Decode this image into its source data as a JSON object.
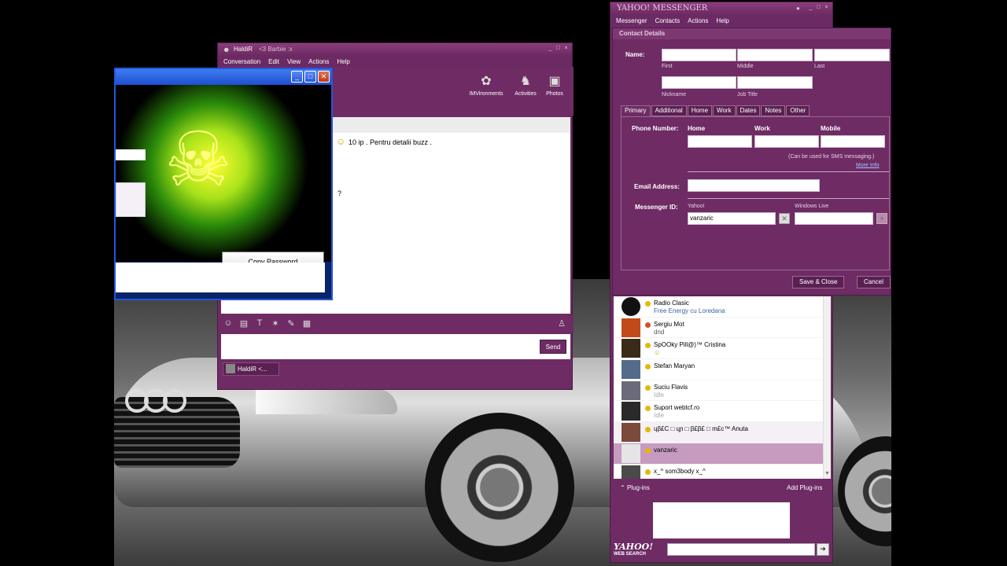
{
  "chat": {
    "title": "HaldiR",
    "title_suffix": "<3 Barbie :x",
    "menu": [
      "Conversation",
      "Edit",
      "View",
      "Actions",
      "Help"
    ],
    "tools": [
      {
        "label": "IMVironments",
        "icon": "imvironment-icon"
      },
      {
        "label": "Activities",
        "icon": "activities-icon"
      },
      {
        "label": "Photos",
        "icon": "photos-icon"
      }
    ],
    "message_line1": "10 ip . Pentru detalii buzz .",
    "message_line2": "?",
    "send_label": "Send",
    "tab_label": "HaldiR   <...",
    "accent": "#6e2b64"
  },
  "popup": {
    "copy_label": "Copy Password"
  },
  "messenger": {
    "title": "YAHOO! MESSENGER",
    "menu": [
      "Messenger",
      "Contacts",
      "Actions",
      "Help"
    ],
    "buddies": [
      {
        "name": "Radio Clasic",
        "status": "Free Energy cu Loredana",
        "status_color": "#3a62a8",
        "dot": "#e6b800",
        "avatar": "#111"
      },
      {
        "name": "Sergiu Mot",
        "status": "dnd",
        "status_color": "#555",
        "dot": "#d94f2a",
        "avatar": "#c24a1a"
      },
      {
        "name": "SpOOky Pill@)™ Cristina",
        "status": "☺",
        "status_color": "#c9a000",
        "dot": "#e6b800",
        "avatar": "#3a2a1a"
      },
      {
        "name": "Stefan Maryan",
        "status": "",
        "status_color": "#888",
        "dot": "#e6b800",
        "avatar": "#556b8a"
      },
      {
        "name": "Suciu Flavis",
        "status": "Idle",
        "status_color": "#aaa",
        "dot": "#e6b800",
        "avatar": "#6a6a7a"
      },
      {
        "name": "Suport webtcf.ro",
        "status": "Idle",
        "status_color": "#aaa",
        "dot": "#e6b800",
        "avatar": "#2a2a2a"
      },
      {
        "name": "ɥβ£Ϲ □ ɥɲ □ β£β£ □ m£c™ Anuta",
        "status": "",
        "status_color": "#888",
        "dot": "#e6b800",
        "avatar": "#7a4a3a"
      },
      {
        "name": "vanzaric",
        "status": "",
        "status_color": "#888",
        "dot": "#e6b800",
        "avatar": "#e5e5e5",
        "selected": true
      },
      {
        "name": "x_^ som3body x_^",
        "status": "",
        "status_color": "#888",
        "dot": "#e6b800",
        "avatar": "#4a4a4a"
      }
    ],
    "plugins_label": "Plug-ins",
    "add_plugins_label": "Add Plug-ins",
    "search_logo": "YAHOO!",
    "search_sub": "WEB SEARCH",
    "search_placeholder": ""
  },
  "details": {
    "header": "Contact Details",
    "name_label": "Name:",
    "first_label": "First",
    "middle_label": "Middle",
    "last_label": "Last",
    "nickname_label": "Nickname",
    "jobtitle_label": "Job Title",
    "tabs": [
      "Primary",
      "Additional",
      "Home",
      "Work",
      "Dates",
      "Notes",
      "Other"
    ],
    "phone_label": "Phone Number:",
    "phone_home": "Home",
    "phone_work": "Work",
    "phone_mobile": "Mobile",
    "sms_note": "(Can be used for SMS messaging.)",
    "more_info": "More Info",
    "email_label": "Email Address:",
    "messenger_id_label": "Messenger ID:",
    "yahoo_label": "Yahoo!",
    "yahoo_value": "vanzaric",
    "winlive_label": "Windows Live",
    "save_label": "Save & Close",
    "cancel_label": "Cancel"
  }
}
